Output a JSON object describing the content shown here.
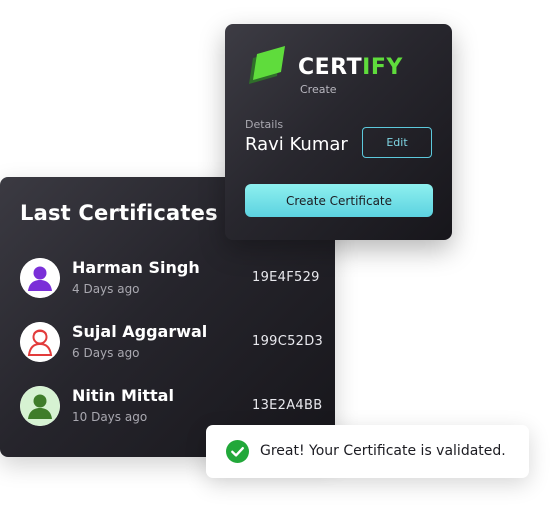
{
  "last_certificates": {
    "title": "Last Certificates",
    "items": [
      {
        "name": "Harman Singh",
        "date": "4 Days ago",
        "id": "19E4F529",
        "avatar_icon": "person-purple-icon",
        "avatar_color": "#7a2fd8"
      },
      {
        "name": "Sujal Aggarwal",
        "date": "6 Days ago",
        "id": "199C52D3",
        "avatar_icon": "person-red-icon",
        "avatar_color": "#e23b3b"
      },
      {
        "name": "Nitin Mittal",
        "date": "10 Days ago",
        "id": "13E2A4BB",
        "avatar_icon": "person-green-icon",
        "avatar_color": "#3f7d2a"
      }
    ]
  },
  "certify": {
    "brand_part1": "CERT",
    "brand_part2": "IFY",
    "subtitle": "Create",
    "details_label": "Details",
    "details_name": "Ravi Kumar",
    "edit_label": "Edit",
    "create_label": "Create Certificate",
    "accent": "#5fdc3c",
    "button_color": "#7ee6ea"
  },
  "toast": {
    "message": "Great! Your Certificate is validated.",
    "icon": "check-circle-icon",
    "icon_color": "#22a83a"
  }
}
